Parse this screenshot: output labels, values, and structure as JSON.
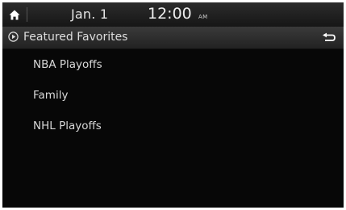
{
  "status_bar": {
    "home_icon": "home-icon",
    "date": "Jan.  1",
    "time": "12:00",
    "ampm": "AM"
  },
  "title_bar": {
    "play_icon": "play-circle-icon",
    "title": "Featured Favorites",
    "back_icon": "back-arrow-icon"
  },
  "list": {
    "items": [
      {
        "label": "NBA Playoffs"
      },
      {
        "label": "Family"
      },
      {
        "label": "NHL Playoffs"
      }
    ]
  },
  "colors": {
    "background": "#070707",
    "text": "#d8d8d8",
    "status_bar": "#222222",
    "title_bar": "#2e2e2e"
  }
}
